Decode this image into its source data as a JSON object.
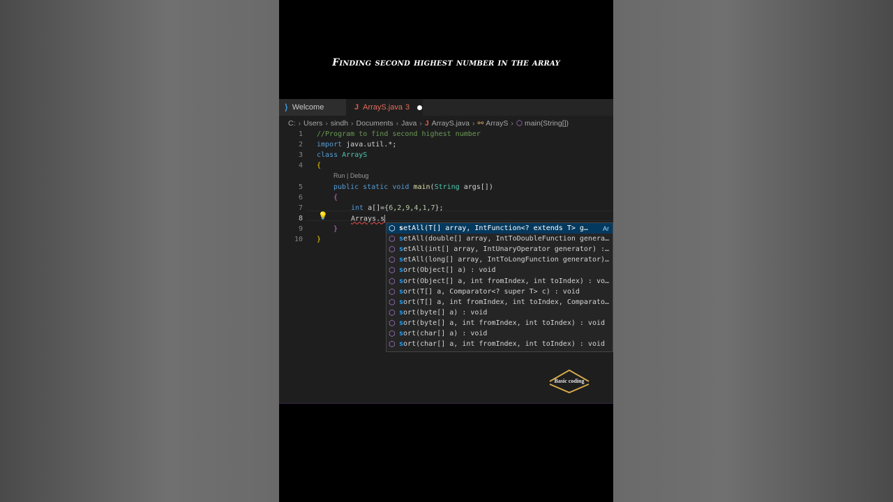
{
  "video": {
    "title": "Finding second highest number in the array"
  },
  "tabs": [
    {
      "label": "Welcome"
    },
    {
      "label": "ArrayS.java",
      "problems": "3"
    }
  ],
  "breadcrumb": [
    "C:",
    "Users",
    "sindh",
    "Documents",
    "Java",
    "ArrayS.java",
    "ArrayS",
    "main(String[])"
  ],
  "codelens": "Run | Debug",
  "editor": {
    "active_line": 8,
    "lines": [
      {
        "n": "1",
        "text": "//Program to find second highest number"
      },
      {
        "n": "2",
        "text": "import java.util.*;"
      },
      {
        "n": "3",
        "text": "class ArrayS"
      },
      {
        "n": "4",
        "text": "{"
      },
      {
        "n": "5",
        "text": "public static void main(String args[])"
      },
      {
        "n": "6",
        "text": "{"
      },
      {
        "n": "7",
        "text": "int a[]={6,2,9,4,1,7};"
      },
      {
        "n": "8",
        "text": "Arrays.s"
      },
      {
        "n": "9",
        "text": "}"
      },
      {
        "n": "10",
        "text": "}"
      }
    ]
  },
  "suggestions": {
    "items": [
      {
        "prefix": "s",
        "rest": "etAll(T[] array, IntFunction<? extends T> g…",
        "detail": "Ar",
        "selected": true
      },
      {
        "prefix": "s",
        "rest": "etAll(double[] array, IntToDoubleFunction genera…"
      },
      {
        "prefix": "s",
        "rest": "etAll(int[] array, IntUnaryOperator generator) :…"
      },
      {
        "prefix": "s",
        "rest": "etAll(long[] array, IntToLongFunction generator)…"
      },
      {
        "prefix": "s",
        "rest": "ort(Object[] a) : void"
      },
      {
        "prefix": "s",
        "rest": "ort(Object[] a, int fromIndex, int toIndex) : vo…"
      },
      {
        "prefix": "s",
        "rest": "ort(T[] a, Comparator<? super T> c) : void"
      },
      {
        "prefix": "s",
        "rest": "ort(T[] a, int fromIndex, int toIndex, Comparato…"
      },
      {
        "prefix": "s",
        "rest": "ort(byte[] a) : void"
      },
      {
        "prefix": "s",
        "rest": "ort(byte[] a, int fromIndex, int toIndex) : void"
      },
      {
        "prefix": "s",
        "rest": "ort(char[] a) : void"
      },
      {
        "prefix": "s",
        "rest": "ort(char[] a, int fromIndex, int toIndex) : void"
      }
    ]
  },
  "watermark": {
    "text": "Basic coding"
  },
  "colors": {
    "accent": "#04395e",
    "tab_modified": "#e36c5d",
    "background": "#1e1e1e"
  }
}
